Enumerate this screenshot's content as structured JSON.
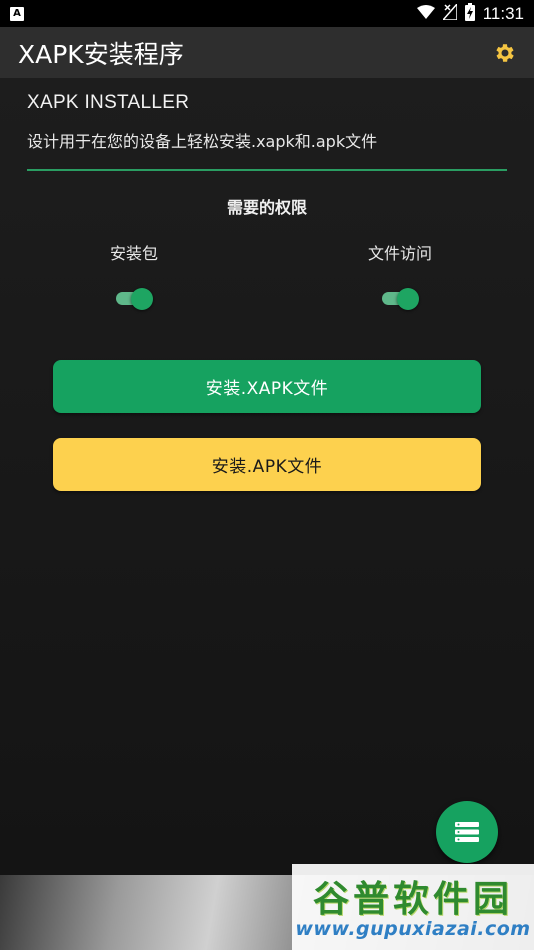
{
  "status_bar": {
    "notification_icon": "A",
    "time": "11:31",
    "icons": [
      "wifi-icon",
      "no-signal-icon",
      "battery-charging-icon"
    ]
  },
  "app_bar": {
    "title": "XAPK安装程序",
    "settings_icon": "gear-icon",
    "accent_color": "#f5c542"
  },
  "header": {
    "brand": "XAPK INSTALLER",
    "description": "设计用于在您的设备上轻松安装.xapk和.apk文件",
    "divider_color": "#2a9d62"
  },
  "permissions": {
    "title": "需要的权限",
    "items": [
      {
        "label": "安装包",
        "enabled": true
      },
      {
        "label": "文件访问",
        "enabled": true
      }
    ]
  },
  "buttons": {
    "install_xapk": "安装.XAPK文件",
    "install_apk": "安装.APK文件",
    "xapk_color": "#16a260",
    "apk_color": "#fdd14e"
  },
  "fab": {
    "icon": "list-icon"
  },
  "watermark": {
    "title": "谷普软件园",
    "url": "www.gupuxiazai.com"
  }
}
